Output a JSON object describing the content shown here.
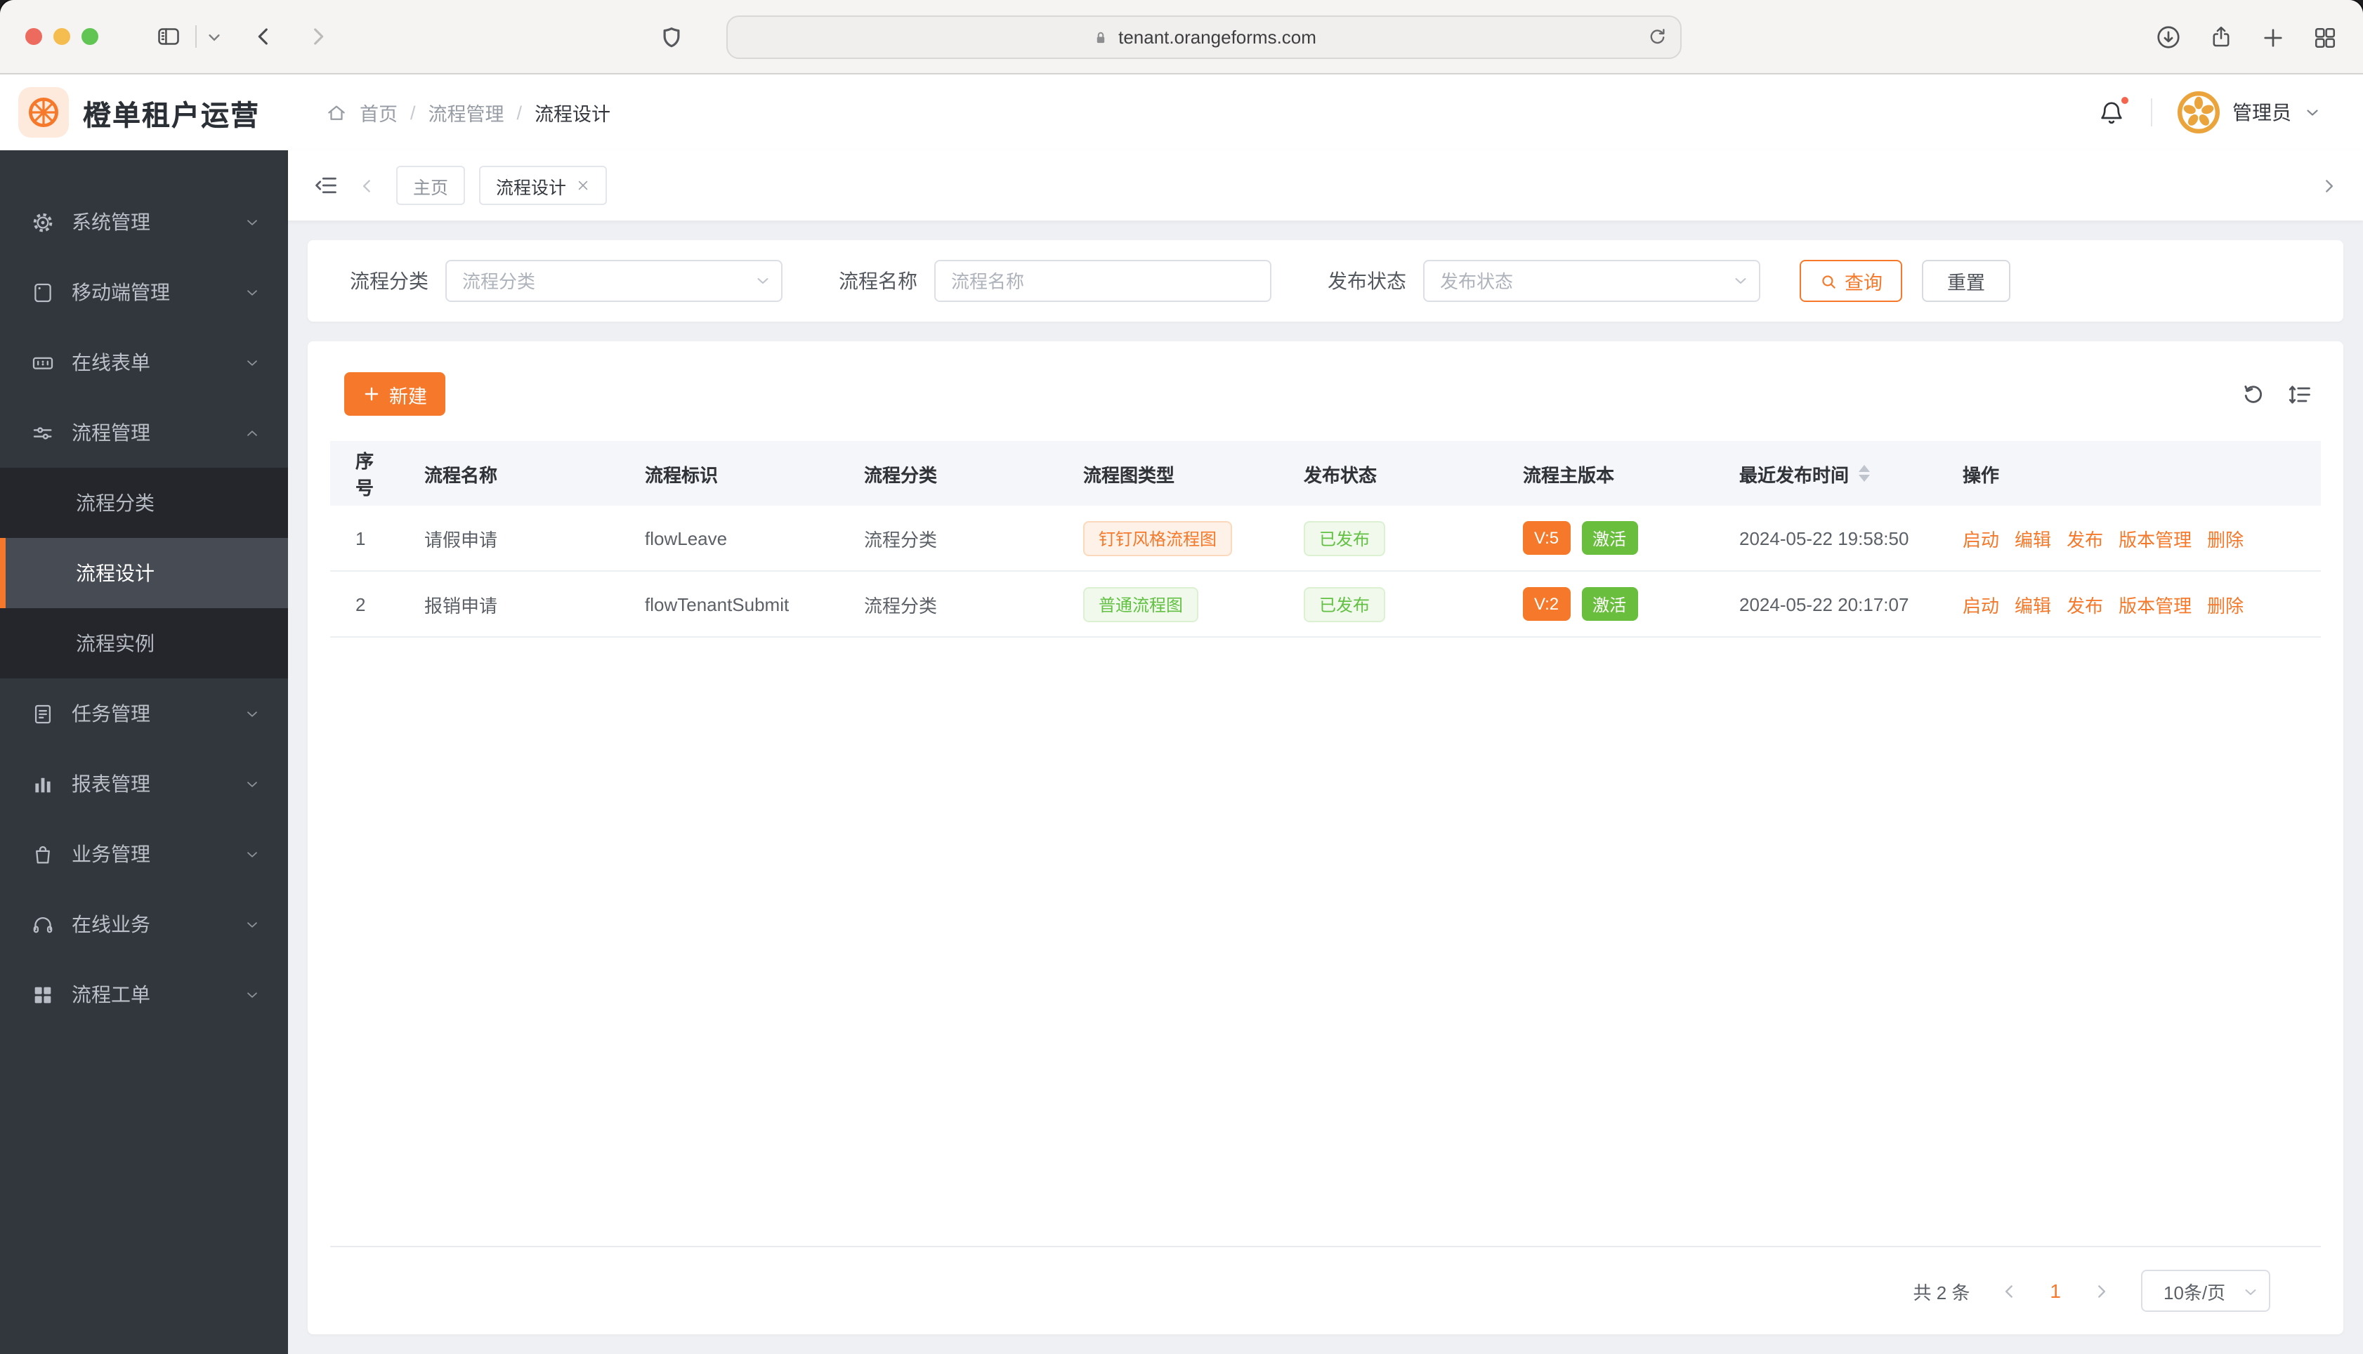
{
  "browser": {
    "url": "tenant.orangeforms.com"
  },
  "header": {
    "app_title": "橙单租户运营",
    "breadcrumb": [
      "首页",
      "流程管理",
      "流程设计"
    ],
    "user_name": "管理员"
  },
  "sidebar": {
    "items": [
      {
        "label": "系统管理"
      },
      {
        "label": "移动端管理"
      },
      {
        "label": "在线表单"
      },
      {
        "label": "流程管理",
        "expanded": true,
        "children": [
          "流程分类",
          "流程设计",
          "流程实例"
        ],
        "active_child": "流程设计"
      },
      {
        "label": "任务管理"
      },
      {
        "label": "报表管理"
      },
      {
        "label": "业务管理"
      },
      {
        "label": "在线业务"
      },
      {
        "label": "流程工单"
      }
    ]
  },
  "tabbar": {
    "tabs": [
      {
        "label": "主页",
        "active": false
      },
      {
        "label": "流程设计",
        "active": true,
        "closable": true
      }
    ]
  },
  "filters": {
    "category_label": "流程分类",
    "category_placeholder": "流程分类",
    "name_label": "流程名称",
    "name_placeholder": "流程名称",
    "status_label": "发布状态",
    "status_placeholder": "发布状态",
    "search_button": "查询",
    "reset_button": "重置"
  },
  "toolbar": {
    "new_button": "新建"
  },
  "table": {
    "columns": [
      "序号",
      "流程名称",
      "流程标识",
      "流程分类",
      "流程图类型",
      "发布状态",
      "流程主版本",
      "最近发布时间",
      "操作"
    ],
    "rows": [
      {
        "index": "1",
        "name": "请假申请",
        "key": "flowLeave",
        "category": "流程分类",
        "diagram_type": "钉钉风格流程图",
        "publish_status": "已发布",
        "version": "V:5",
        "version_state": "激活",
        "published_at": "2024-05-22 19:58:50"
      },
      {
        "index": "2",
        "name": "报销申请",
        "key": "flowTenantSubmit",
        "category": "流程分类",
        "diagram_type": "普通流程图",
        "publish_status": "已发布",
        "version": "V:2",
        "version_state": "激活",
        "published_at": "2024-05-22 20:17:07"
      }
    ],
    "actions": [
      "启动",
      "编辑",
      "发布",
      "版本管理",
      "删除"
    ]
  },
  "pagination": {
    "total": "共 2 条",
    "page": "1",
    "page_size": "10条/页"
  },
  "colors": {
    "primary_orange": "#f6792b",
    "success_green": "#67c23a",
    "sidebar_bg": "#32363d",
    "table_header_bg": "#f4f6f9"
  },
  "icons": {
    "logo": "orange-wheel-icon",
    "avatar": "orange-slice-icon",
    "notification": "bell-icon",
    "search": "magnifier-icon",
    "new": "plus-icon",
    "refresh": "refresh-icon",
    "row_settings": "row-height-icon"
  }
}
